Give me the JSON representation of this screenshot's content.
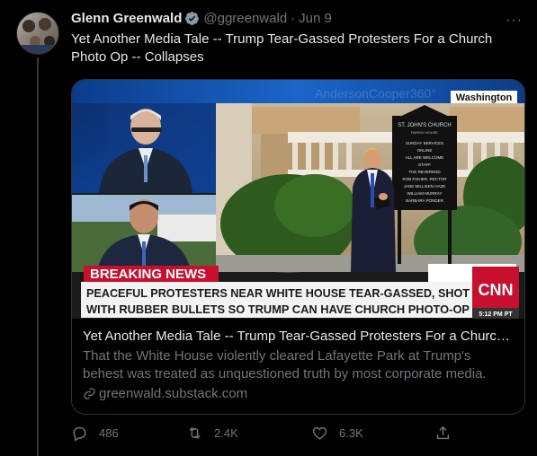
{
  "tweet": {
    "author_name": "Glenn Greenwald",
    "author_handle": "@ggreenwald",
    "separator": "·",
    "date": "Jun 9",
    "text": "Yet Another Media Tale -- Trump Tear-Gassed Protesters For a Church Photo Op -- Collapses",
    "more_label": "···"
  },
  "card": {
    "title": "Yet Another Media Tale -- Trump Tear-Gassed Protesters For a Churc…",
    "description": "That the White House violently cleared Lafayette Park at Trump's behest was treated as unquestioned truth by most corporate media. Today it …",
    "domain": "greenwald.substack.com",
    "image": {
      "show_label": "AndersonCooper360°",
      "location_tag": "Washington",
      "banner_label": "BREAKING NEWS",
      "headline_line1": "PEACEFUL PROTESTERS NEAR WHITE HOUSE TEAR-GASSED, SHOT",
      "headline_line2": "WITH RUBBER BULLETS SO TRUMP CAN HAVE CHURCH PHOTO-OP",
      "network_logo": "CNN",
      "time": "5:12 PM PT",
      "church_sign_title": "ST. JOHN'S CHURCH",
      "church_sign_subtitle": "PARISH HOUSE",
      "church_sign_lines": [
        "SUNDAY SERVICES",
        "ONLINE",
        "ALL ARE WELCOME",
        "STAFF",
        "THE REVEREND",
        "ROB FISHER, RECTOR",
        "JANE MILLIKEN HAZE",
        "WILLIAM MURRAY",
        "BARBARA PONDER"
      ]
    }
  },
  "actions": {
    "replies": "486",
    "retweets": "2.4K",
    "likes": "6.3K"
  },
  "colors": {
    "background": "#000000",
    "primary_text": "#e7e9ea",
    "secondary_text": "#71767b",
    "verified": "#8b98a5",
    "breaking_red": "#c8102e"
  }
}
